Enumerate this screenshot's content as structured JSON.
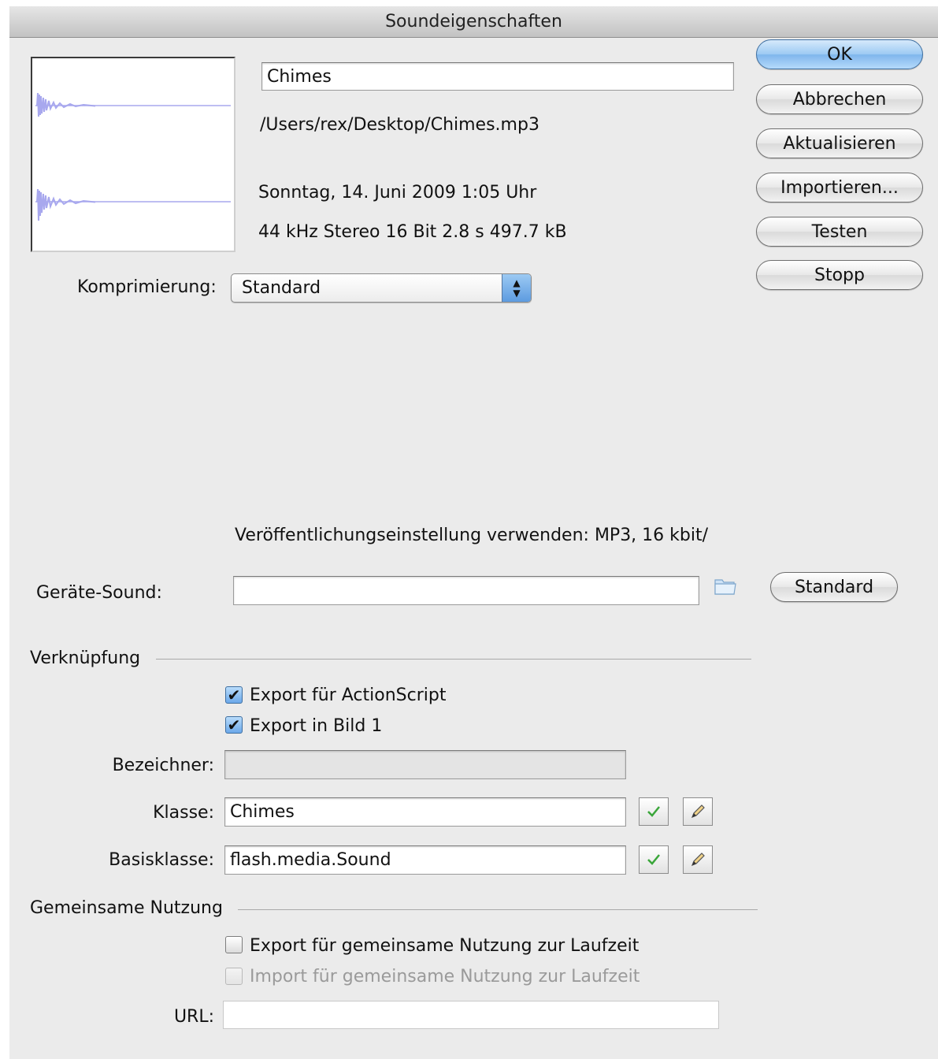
{
  "window": {
    "title": "Soundeigenschaften"
  },
  "sound": {
    "name": "Chimes",
    "path": "/Users/rex/Desktop/Chimes.mp3",
    "date": "Sonntag, 14. Juni 2009  1:05 Uhr",
    "info": "44 kHz Stereo 16 Bit 2.8 s 497.7 kB"
  },
  "buttons": {
    "ok": "OK",
    "cancel": "Abbrechen",
    "update": "Aktualisieren",
    "import": "Importieren...",
    "test": "Testen",
    "stop": "Stopp"
  },
  "compression": {
    "label": "Komprimierung:",
    "value": "Standard"
  },
  "publish_note": "Veröffentlichungseinstellung verwenden: MP3, 16 kbit/",
  "device_sound": {
    "label": "Geräte-Sound:",
    "value": "",
    "default_button": "Standard"
  },
  "linkage": {
    "section_title": "Verknüpfung",
    "export_actionscript": {
      "label": "Export für ActionScript",
      "checked": true
    },
    "export_frame1": {
      "label": "Export in Bild 1",
      "checked": true
    },
    "identifier": {
      "label": "Bezeichner:",
      "value": ""
    },
    "class": {
      "label": "Klasse:",
      "value": "Chimes"
    },
    "base_class": {
      "label": "Basisklasse:",
      "value": "flash.media.Sound"
    }
  },
  "sharing": {
    "section_title": "Gemeinsame Nutzung",
    "export_runtime": {
      "label": "Export für gemeinsame Nutzung zur Laufzeit",
      "checked": false
    },
    "import_runtime": {
      "label": "Import für gemeinsame Nutzung zur Laufzeit",
      "checked": false,
      "disabled": true
    },
    "url": {
      "label": "URL:",
      "value": ""
    }
  },
  "colors": {
    "default_button": "#7fb6ec",
    "waveform": "#a8a8ee",
    "check_valid": "#3aa63a"
  },
  "icons": [
    "folder-icon",
    "checkmark-icon",
    "pencil-icon"
  ]
}
